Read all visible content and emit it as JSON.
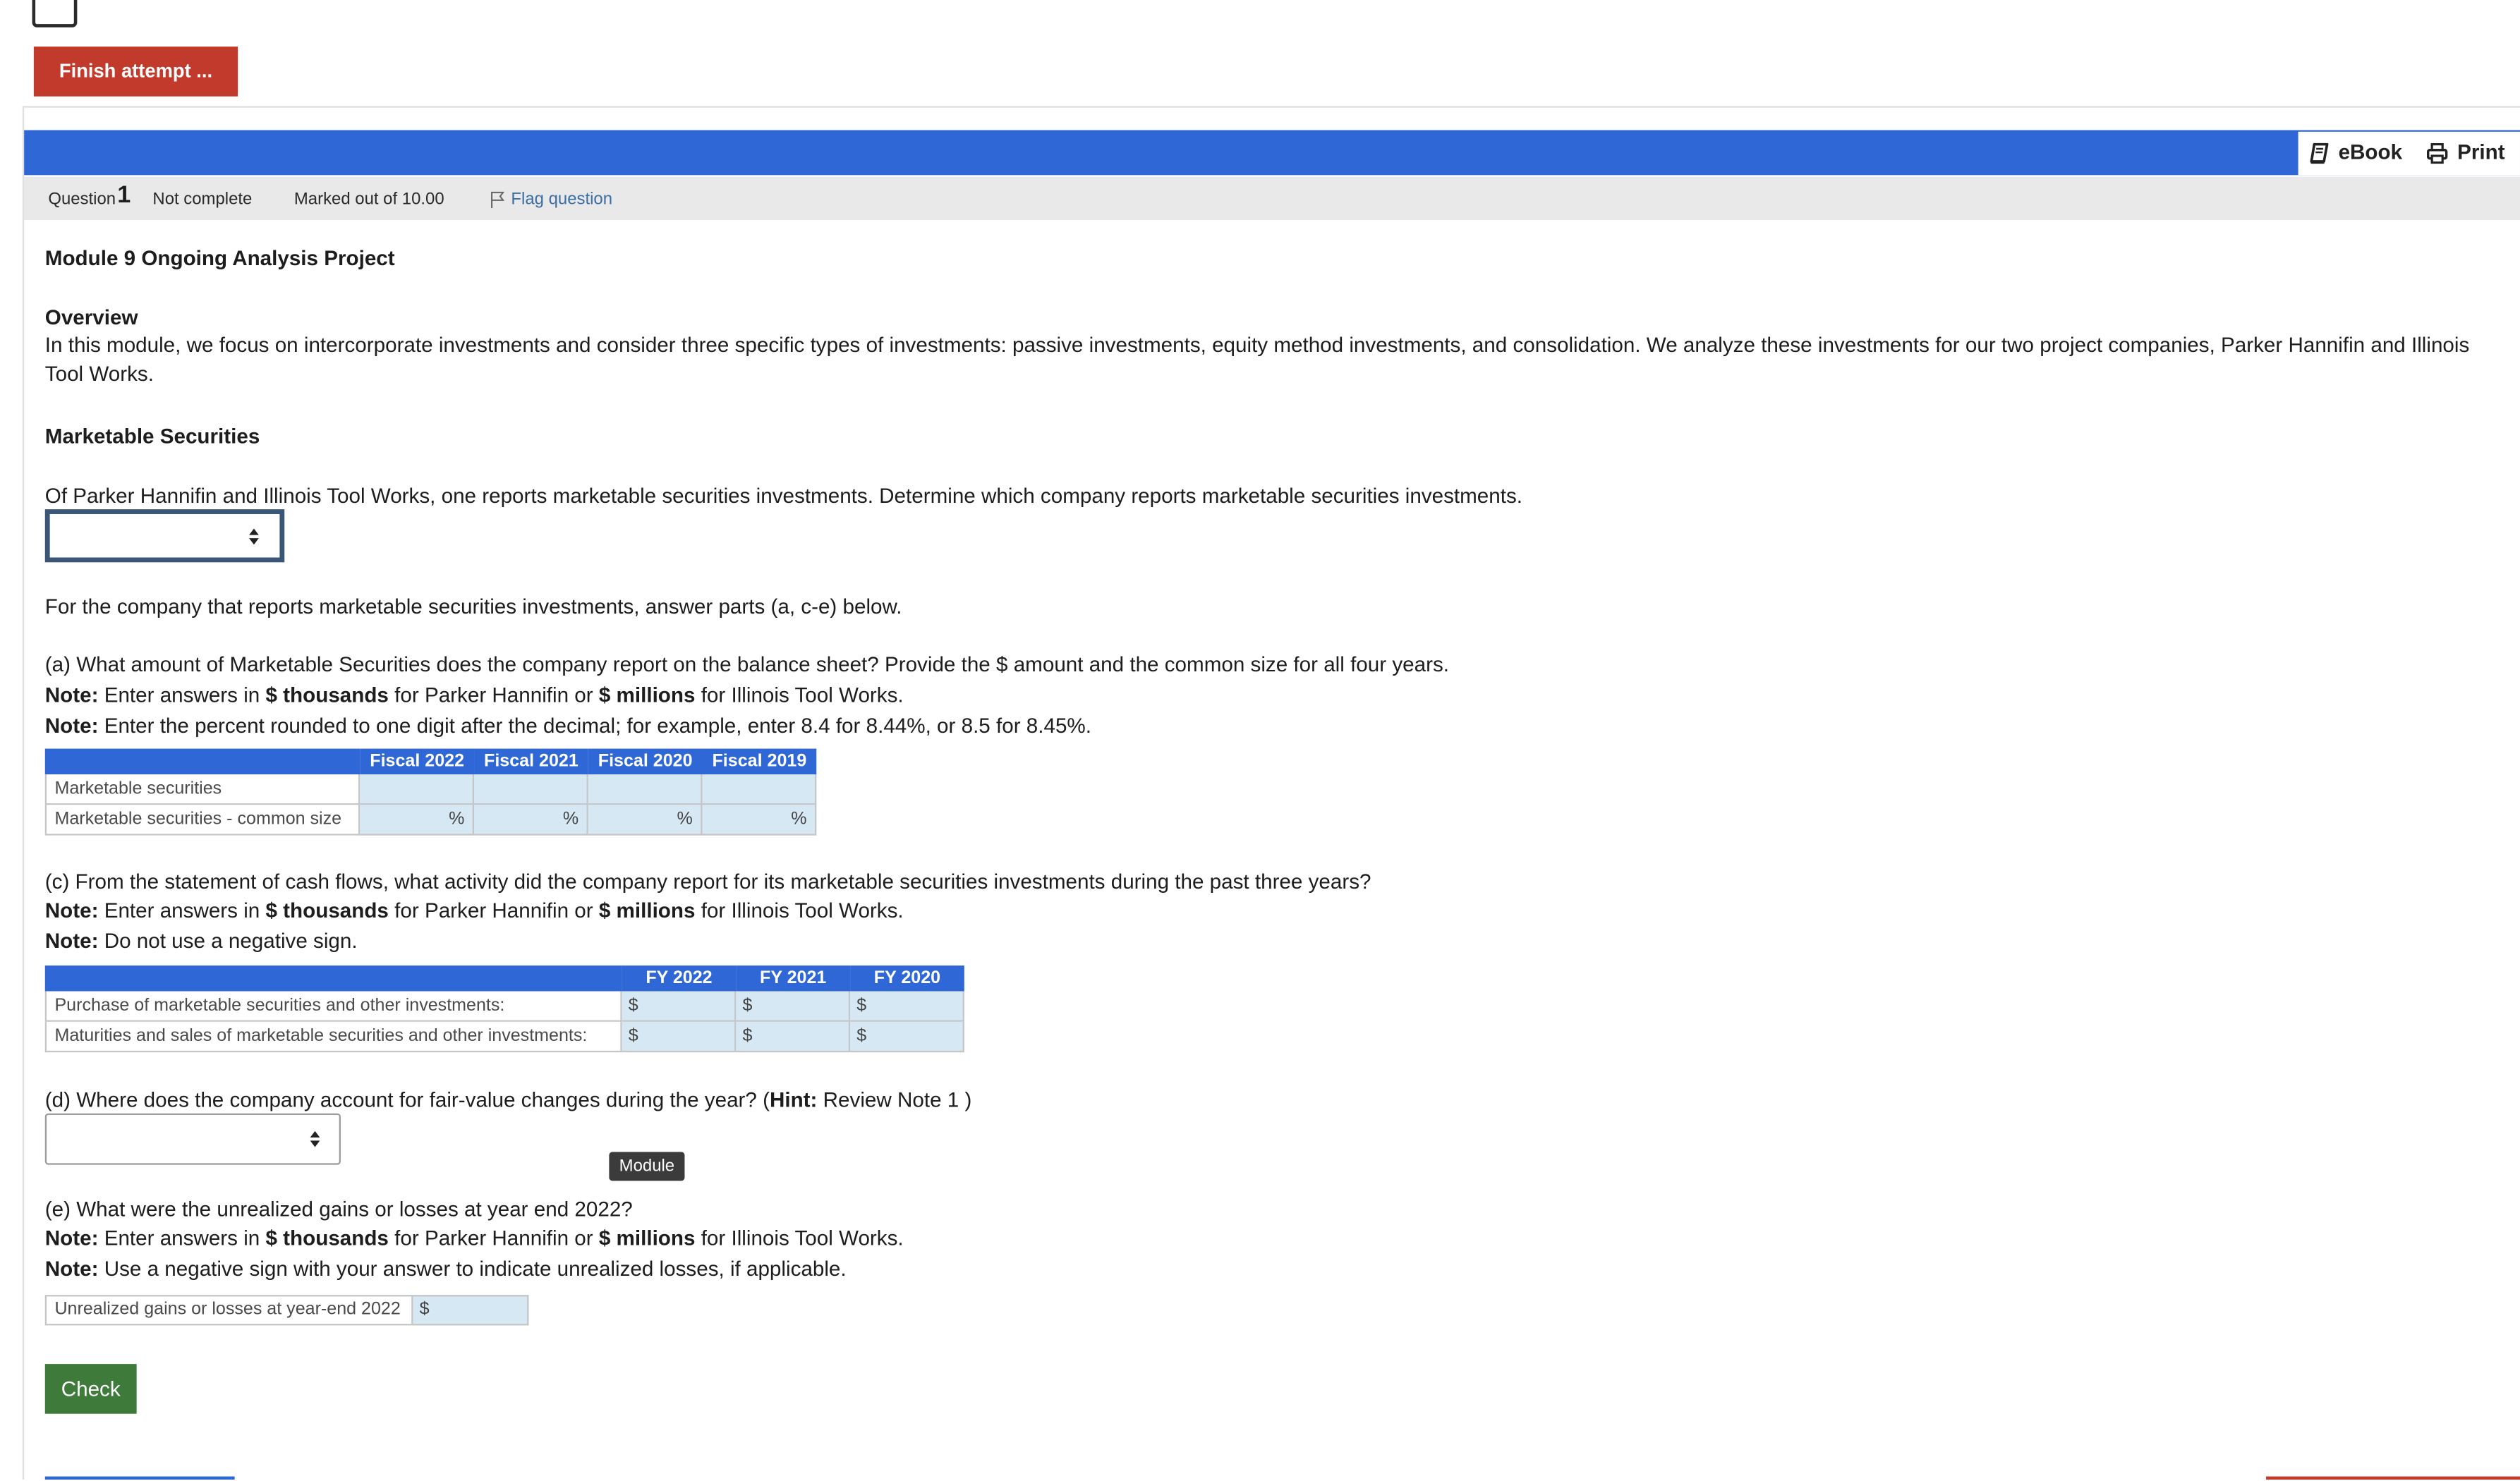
{
  "nav": {
    "finish_attempt_label": "Finish attempt ..."
  },
  "toolbar": {
    "ebook_label": "eBook",
    "print_label": "Print"
  },
  "question_info": {
    "label": "Question",
    "number": "1",
    "state": "Not complete",
    "grade": "Marked out of 10.00",
    "flag_label": "Flag question"
  },
  "question": {
    "title": "Module 9 Ongoing Analysis Project",
    "overview": {
      "heading": "Overview",
      "text": "In this module, we focus on intercorporate investments and consider three specific types of investments: passive investments, equity method investments, and consolidation. We analyze these investments for our two project companies, Parker Hannifin and Illinois Tool Works."
    },
    "section_heading": "Marketable Securities",
    "company_prompt": "Of Parker Hannifin and Illinois Tool Works, one reports marketable securities investments. Determine which company reports marketable securities investments.",
    "instructions": "For the company that reports marketable securities investments, answer parts (a, c-e) below.",
    "part_a": {
      "prompt": "(a) What amount of Marketable Securities does the company report on the balance sheet? Provide the $ amount and the common size for all four years.",
      "note_units": {
        "label": "Note:",
        "t1": " Enter answers in ",
        "b1": "$ thousands",
        "t2": " for Parker Hannifin or ",
        "b2": "$ millions",
        "t3": " for Illinois Tool Works."
      },
      "note_percent": {
        "label": "Note:",
        "text": " Enter the percent rounded to one digit after the decimal; for example, enter 8.4 for 8.44%, or 8.5 for 8.45%."
      },
      "table": {
        "headers": [
          "Fiscal 2022",
          "Fiscal 2021",
          "Fiscal 2020",
          "Fiscal 2019"
        ],
        "rows": [
          {
            "label": "Marketable securities"
          },
          {
            "label": "Marketable securities - common size",
            "unit": "%"
          }
        ]
      }
    },
    "part_c": {
      "prompt": "(c) From the statement of cash flows, what activity did the company report for its marketable securities investments during the past three years?",
      "note_units": {
        "label": "Note:",
        "t1": " Enter answers in ",
        "b1": "$ thousands",
        "t2": " for Parker Hannifin or ",
        "b2": "$ millions",
        "t3": " for Illinois Tool Works."
      },
      "note_sign": {
        "label": "Note:",
        "text": " Do not use a negative sign."
      },
      "table": {
        "headers": [
          "FY 2022",
          "FY 2021",
          "FY 2020"
        ],
        "currency": "$",
        "rows": [
          {
            "label": "Purchase of marketable securities and other investments:"
          },
          {
            "label": "Maturities and sales of marketable securities and other investments:"
          }
        ]
      }
    },
    "part_d": {
      "prompt_start": "(d) Where does the company account for fair-value changes during the year? (",
      "hint_label": "Hint:",
      "prompt_end": " Review Note 1 )",
      "tooltip": "Module"
    },
    "part_e": {
      "prompt": "(e) What were the unrealized gains or losses at year end 2022?",
      "note_units": {
        "label": "Note:",
        "t1": " Enter answers in ",
        "b1": "$ thousands",
        "t2": " for Parker Hannifin or ",
        "b2": "$ millions",
        "t3": " for Illinois Tool Works."
      },
      "note_sign": {
        "label": "Note:",
        "text": " Use a negative sign with your answer to indicate unrealized losses, if applicable."
      },
      "row_label": "Unrealized gains or losses at year-end 2022",
      "currency": "$"
    },
    "check_label": "Check"
  },
  "colors": {
    "accent_blue": "#2f67d6",
    "finish_red": "#c23a2b",
    "check_green": "#3e7b3b",
    "input_bg": "#d7e8f5"
  }
}
